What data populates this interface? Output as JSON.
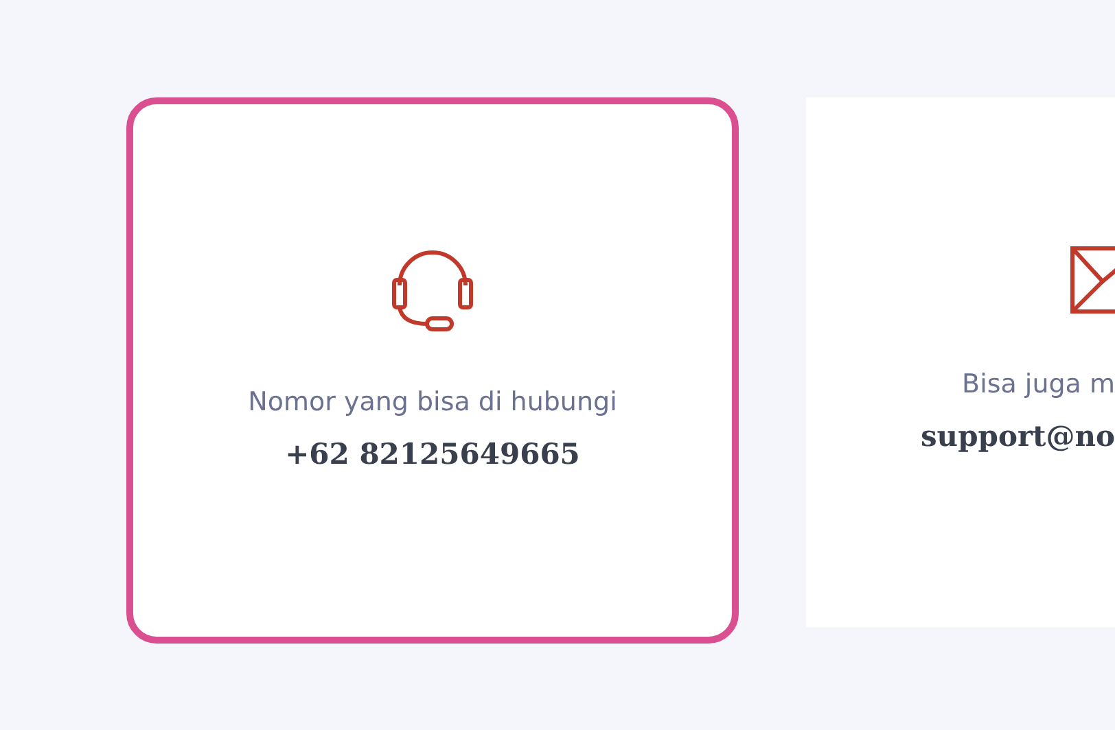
{
  "cards": [
    {
      "kind": "headset",
      "selected": true,
      "label": "Nomor yang bisa di hubungi",
      "value": "+62 82125649665"
    },
    {
      "kind": "mail",
      "selected": false,
      "label": "Bisa juga m",
      "value": "support@no"
    }
  ]
}
